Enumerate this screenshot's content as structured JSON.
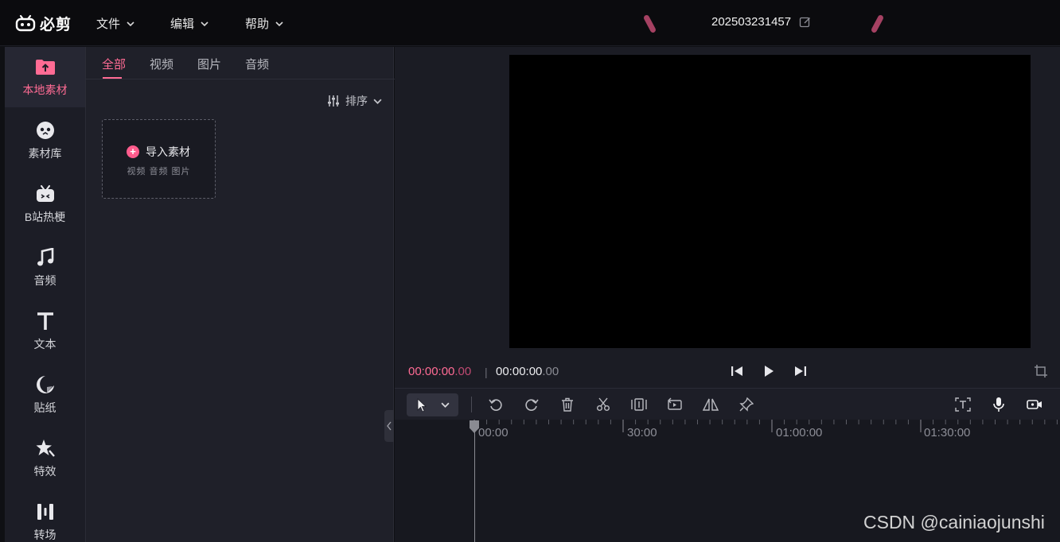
{
  "app": {
    "logo_text": "必剪",
    "menus": [
      {
        "label": "文件"
      },
      {
        "label": "编辑"
      },
      {
        "label": "帮助"
      }
    ],
    "project_title": "202503231457"
  },
  "sidebar": {
    "items": [
      {
        "label": "本地素材",
        "icon": "folder-upload-icon",
        "active": true
      },
      {
        "label": "素材库",
        "icon": "material-library-icon"
      },
      {
        "label": "B站热梗",
        "icon": "bilibili-tv-icon"
      },
      {
        "label": "音频",
        "icon": "music-note-icon"
      },
      {
        "label": "文本",
        "icon": "text-t-icon"
      },
      {
        "label": "贴纸",
        "icon": "sticker-icon"
      },
      {
        "label": "特效",
        "icon": "effects-star-icon"
      },
      {
        "label": "转场",
        "icon": "transition-icon"
      }
    ]
  },
  "media_panel": {
    "tabs": [
      {
        "label": "全部",
        "active": true
      },
      {
        "label": "视频"
      },
      {
        "label": "图片"
      },
      {
        "label": "音频"
      }
    ],
    "sort_label": "排序",
    "import": {
      "label": "导入素材",
      "types": "视频 音频 图片"
    }
  },
  "preview": {
    "current_time": "00:00:00",
    "current_frames": ".00",
    "separator": "|",
    "total_time": "00:00:00",
    "total_frames": ".00"
  },
  "timeline": {
    "ruler_labels": [
      "00:00",
      "30:00",
      "01:00:00",
      "01:30:00"
    ]
  },
  "watermark": "CSDN @cainiaojunshi",
  "colors": {
    "accent": "#ff6b94",
    "background": "#0f1014",
    "panel": "#1f2029"
  }
}
